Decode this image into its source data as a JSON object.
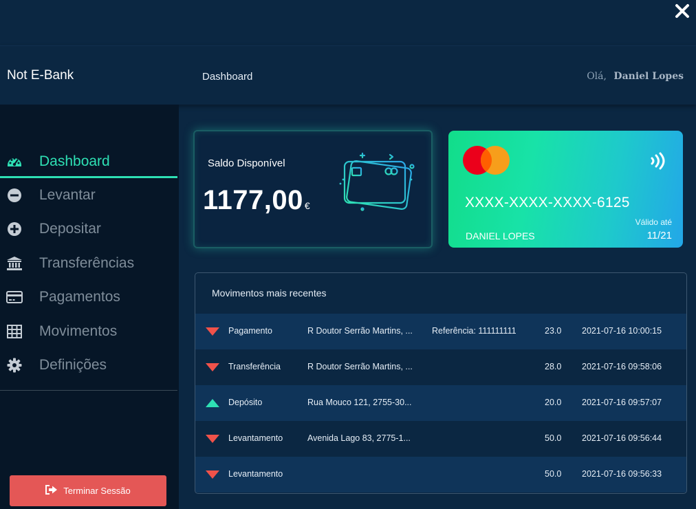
{
  "app": {
    "title": "Not E-Bank"
  },
  "header": {
    "page_title": "Dashboard",
    "greeting": "Olá,",
    "user_name": "Daniel Lopes"
  },
  "sidebar": {
    "items": [
      {
        "label": "Dashboard",
        "icon": "tachometer-icon",
        "active": true
      },
      {
        "label": "Levantar",
        "icon": "minus-circle-icon"
      },
      {
        "label": "Depositar",
        "icon": "plus-circle-icon"
      },
      {
        "label": "Transferências",
        "icon": "bank-icon"
      },
      {
        "label": "Pagamentos",
        "icon": "credit-card-icon"
      },
      {
        "label": "Movimentos",
        "icon": "table-icon"
      },
      {
        "label": "Definições",
        "icon": "cog-icon"
      }
    ],
    "logout_label": "Terminar Sessão"
  },
  "balance": {
    "label": "Saldo Disponível",
    "amount": "1177,00",
    "currency": "€"
  },
  "card": {
    "number": "XXXX-XXXX-XXXX-6125",
    "holder": "DANIEL LOPES",
    "valid_label": "Válido até",
    "valid_date": "11/21",
    "brand_icon": "mastercard-icon",
    "contactless_icon": "contactless-icon"
  },
  "movements": {
    "title": "Movimentos mais recentes",
    "rows": [
      {
        "direction": "down",
        "type": "Pagamento",
        "address": "R Doutor Serrão Martins, ...",
        "reference": "Referência: 111111111",
        "amount": "23.0",
        "date": "2021-07-16 10:00:15"
      },
      {
        "direction": "down",
        "type": "Transferência",
        "address": "R Doutor Serrão Martins, ...",
        "reference": "",
        "amount": "28.0",
        "date": "2021-07-16 09:58:06"
      },
      {
        "direction": "up",
        "type": "Depósito",
        "address": "Rua Mouco 121, 2755-30...",
        "reference": "",
        "amount": "20.0",
        "date": "2021-07-16 09:57:07"
      },
      {
        "direction": "down",
        "type": "Levantamento",
        "address": "Avenida Lago 83, 2775-1...",
        "reference": "",
        "amount": "50.0",
        "date": "2021-07-16 09:56:44"
      },
      {
        "direction": "down",
        "type": "Levantamento",
        "address": "",
        "reference": "",
        "amount": "50.0",
        "date": "2021-07-16 09:56:33"
      }
    ]
  },
  "colors": {
    "accent": "#2ee0b4",
    "danger": "#e45756",
    "arrow_down": "#f0524a",
    "arrow_up": "#2ee0b4"
  }
}
